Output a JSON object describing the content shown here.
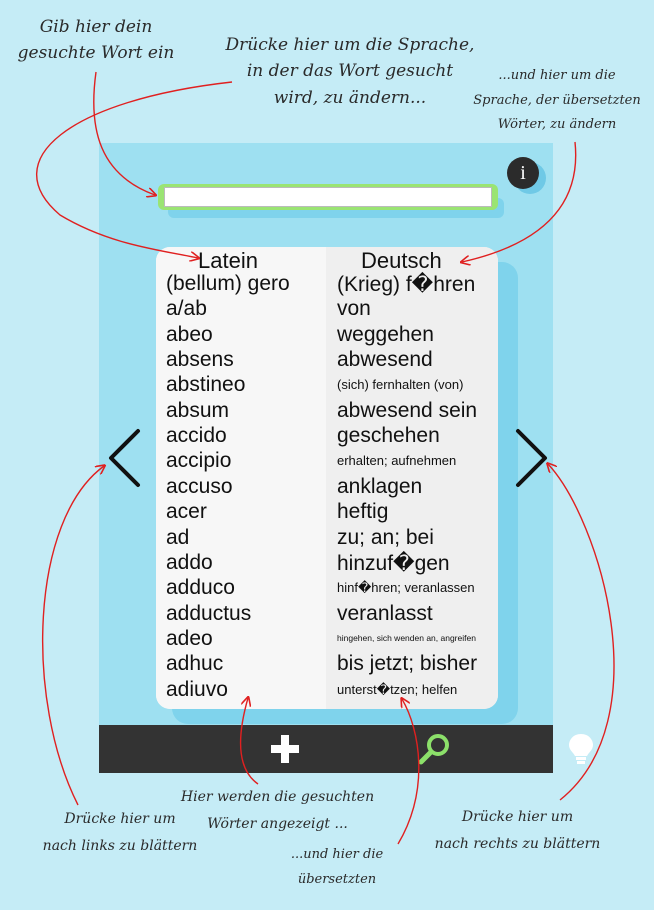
{
  "annotations": {
    "search_hint": [
      "Gib hier dein",
      "gesuchte Wort ein"
    ],
    "source_lang_hint": [
      "Drücke hier um die Sprache,",
      "in der das Wort gesucht",
      "wird, zu ändern..."
    ],
    "target_lang_hint": [
      "...und hier um die",
      "Sprache, der übersetzten",
      "Wörter, zu ändern"
    ],
    "prev_page_hint": [
      "Drücke hier um",
      "nach links zu blättern"
    ],
    "results_hint": [
      "Hier werden die gesuchten",
      "Wörter angezeigt ..."
    ],
    "translations_hint": [
      "...und hier die",
      "übersetzten"
    ],
    "next_page_hint": [
      "Drücke hier um",
      "nach rechts zu blättern"
    ]
  },
  "header": {
    "info_label": "i",
    "search": {
      "value": "",
      "placeholder": ""
    }
  },
  "languages": {
    "source": "Latein",
    "target": "Deutsch"
  },
  "entries": [
    {
      "latin": "(bellum) gero",
      "german": "(Krieg) f�hren",
      "size": "l"
    },
    {
      "latin": "a/ab",
      "german": "von",
      "size": "l"
    },
    {
      "latin": "abeo",
      "german": "weggehen",
      "size": "l"
    },
    {
      "latin": "absens",
      "german": "abwesend",
      "size": "l"
    },
    {
      "latin": "abstineo",
      "german": "(sich) fernhalten (von)",
      "size": "s"
    },
    {
      "latin": "absum",
      "german": "abwesend sein",
      "size": "l"
    },
    {
      "latin": "accido",
      "german": "geschehen",
      "size": "l"
    },
    {
      "latin": "accipio",
      "german": "erhalten; aufnehmen",
      "size": "s"
    },
    {
      "latin": "accuso",
      "german": "anklagen",
      "size": "l"
    },
    {
      "latin": "acer",
      "german": " heftig",
      "size": "l"
    },
    {
      "latin": "ad",
      "german": "zu; an; bei",
      "size": "l"
    },
    {
      "latin": "addo",
      "german": "hinzuf�gen",
      "size": "l"
    },
    {
      "latin": "adduco",
      "german": "hinf�hren; veranlassen",
      "size": "s"
    },
    {
      "latin": "adductus",
      "german": "veranlasst",
      "size": "l"
    },
    {
      "latin": "adeo",
      "german": "hingehen, sich wenden an, angreifen",
      "size": "xs"
    },
    {
      "latin": "adhuc",
      "german": "bis jetzt; bisher",
      "size": "l"
    },
    {
      "latin": "adiuvo",
      "german": "unterst�tzen; helfen",
      "size": "s"
    }
  ],
  "toolbar": {
    "items": [
      {
        "name": "add-icon"
      },
      {
        "name": "search-icon"
      },
      {
        "name": "lightbulb-icon"
      }
    ]
  },
  "colors": {
    "background": "#c5ecf6",
    "app_panel": "#9ee0f1",
    "search_frame": "#9ae473",
    "toolbar": "#333333",
    "annotation_arrow": "#e02020",
    "search_icon": "#8ce06a"
  }
}
